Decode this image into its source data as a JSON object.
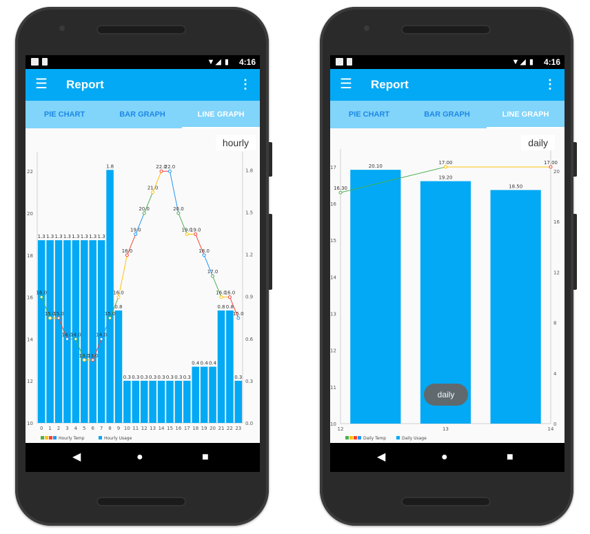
{
  "status_left_icons": [
    "gmail-icon",
    "sd-card-icon"
  ],
  "status_time": "4:16",
  "phones": [
    {
      "app_title": "Report",
      "tabs": [
        {
          "label": "PIE CHART",
          "active": false
        },
        {
          "label": "BAR GRAPH",
          "active": false
        },
        {
          "label": "LINE GRAPH",
          "active": true
        }
      ],
      "filter_label": "hourly",
      "chart_data": {
        "type": "bar",
        "x": [
          0,
          1,
          2,
          3,
          4,
          5,
          6,
          7,
          8,
          9,
          10,
          11,
          12,
          13,
          14,
          15,
          16,
          17,
          18,
          19,
          20,
          21,
          22,
          23
        ],
        "xlim": [
          0,
          23
        ],
        "y_left_ticks": [
          "10",
          "12",
          "14",
          "16",
          "18",
          "20",
          "22"
        ],
        "y_left_lim": [
          10,
          22.6
        ],
        "y_right_ticks": [
          "0.0",
          "0.3",
          "0.6",
          "0.9",
          "1.2",
          "1.5",
          "1.8"
        ],
        "y_right_lim": [
          0,
          1.88
        ],
        "series": [
          {
            "name": "Hourly Usage",
            "kind": "bar",
            "axis": "right",
            "color": "#03a9f4",
            "values": [
              1.3,
              1.3,
              1.3,
              1.3,
              1.3,
              1.3,
              1.3,
              1.3,
              1.8,
              0.8,
              0.3,
              0.3,
              0.3,
              0.3,
              0.3,
              0.3,
              0.3,
              0.3,
              0.4,
              0.4,
              0.4,
              0.8,
              0.8,
              0.3
            ],
            "labels": [
              "1.3",
              "1.3",
              "1.3",
              "1.3",
              "1.3",
              "1.3",
              "1.3",
              "1.3",
              "1.8",
              "0.8",
              "0.3",
              "0.3",
              "0.3",
              "0.3",
              "0.3",
              "0.3",
              "0.3",
              "0.3",
              "0.4",
              "0.4",
              "0.4",
              "0.8",
              "0.8",
              "0.3"
            ]
          },
          {
            "name": "Hourly Temp",
            "kind": "line",
            "axis": "left",
            "colors": [
              "#4caf50",
              "#ffc107",
              "#f44336",
              "#2196f3"
            ],
            "values": [
              16,
              15,
              15,
              14,
              14,
              13,
              13,
              14,
              15,
              16,
              18,
              19,
              20,
              21,
              22,
              22,
              20,
              19,
              19,
              18,
              17,
              16,
              16,
              15
            ],
            "labels": [
              "16.0",
              "15.0",
              "15.0",
              "14.0",
              "14.0",
              "13.0",
              "13.0",
              "14.0",
              "15.0",
              "16.0",
              "18.0",
              "19.0",
              "20.0",
              "21.0",
              "22.0",
              "22.0",
              "20.0",
              "19.0",
              "19.0",
              "18.0",
              "17.0",
              "16.0",
              "16.0",
              "15.0"
            ]
          }
        ],
        "legend": {
          "placement": "bottom-left",
          "entries": [
            "Hourly Temp",
            "Hourly Usage"
          ]
        },
        "grid": false
      }
    },
    {
      "app_title": "Report",
      "tabs": [
        {
          "label": "PIE CHART",
          "active": false
        },
        {
          "label": "BAR GRAPH",
          "active": false
        },
        {
          "label": "LINE GRAPH",
          "active": true
        }
      ],
      "filter_label": "daily",
      "toast": "daily",
      "chart_data": {
        "type": "bar",
        "x": [
          12,
          13,
          14
        ],
        "xlim": [
          12,
          14
        ],
        "x_ticks": [
          "12",
          "13",
          "14"
        ],
        "y_left_ticks": [
          "10",
          "11",
          "12",
          "13",
          "14",
          "15",
          "16",
          "17"
        ],
        "y_left_lim": [
          10,
          17.3
        ],
        "y_right_ticks": [
          "0",
          "4",
          "8",
          "12",
          "16",
          "20"
        ],
        "y_right_lim": [
          0,
          21.2
        ],
        "series": [
          {
            "name": "Daily Usage",
            "kind": "bar",
            "axis": "right",
            "color": "#03a9f4",
            "values": [
              20.1,
              19.2,
              18.5
            ],
            "labels": [
              "20.10",
              "19.20",
              "18.50"
            ]
          },
          {
            "name": "Daily Temp",
            "kind": "line",
            "axis": "left",
            "colors": [
              "#4caf50",
              "#ffc107",
              "#f44336",
              "#2196f3"
            ],
            "values": [
              16.3,
              17.0,
              17.0
            ],
            "labels": [
              "16.30",
              "17.00",
              "17.00"
            ]
          }
        ],
        "legend": {
          "placement": "bottom-left",
          "entries": [
            "Daily Temp",
            "Daily Usage"
          ]
        },
        "grid": false
      }
    }
  ]
}
